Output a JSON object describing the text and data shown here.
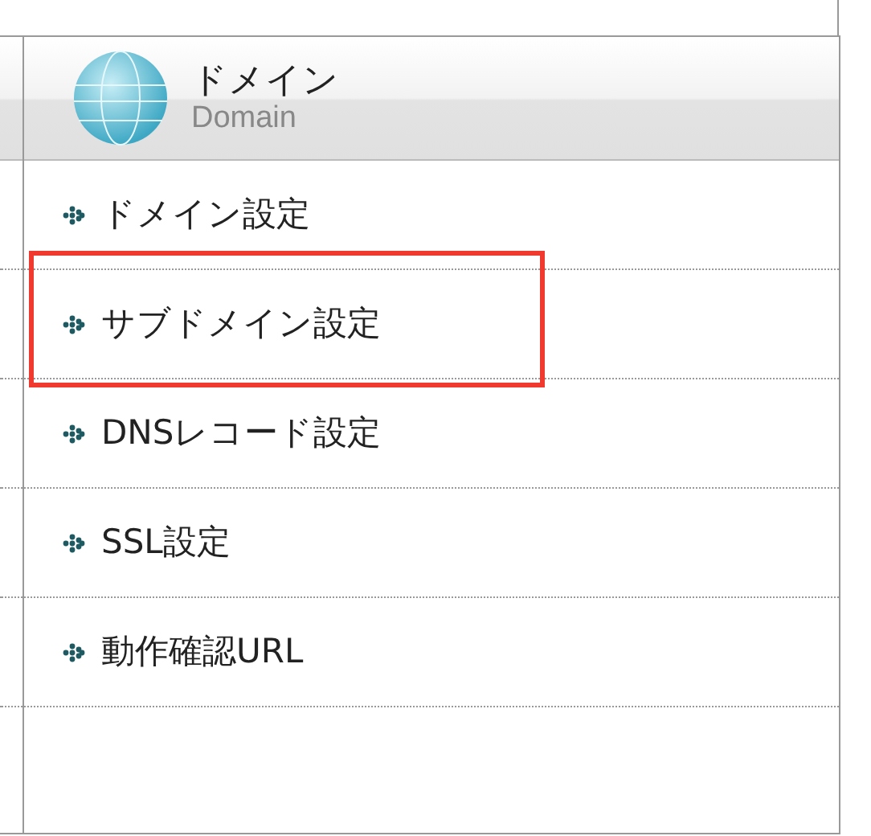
{
  "header": {
    "title": "ドメイン",
    "subtitle": "Domain"
  },
  "menu": [
    {
      "label": "ドメイン設定",
      "highlighted": false
    },
    {
      "label": "サブドメイン設定",
      "highlighted": true
    },
    {
      "label": "DNSレコード設定",
      "highlighted": false
    },
    {
      "label": "SSL設定",
      "highlighted": false
    },
    {
      "label": "動作確認URL",
      "highlighted": false
    }
  ]
}
